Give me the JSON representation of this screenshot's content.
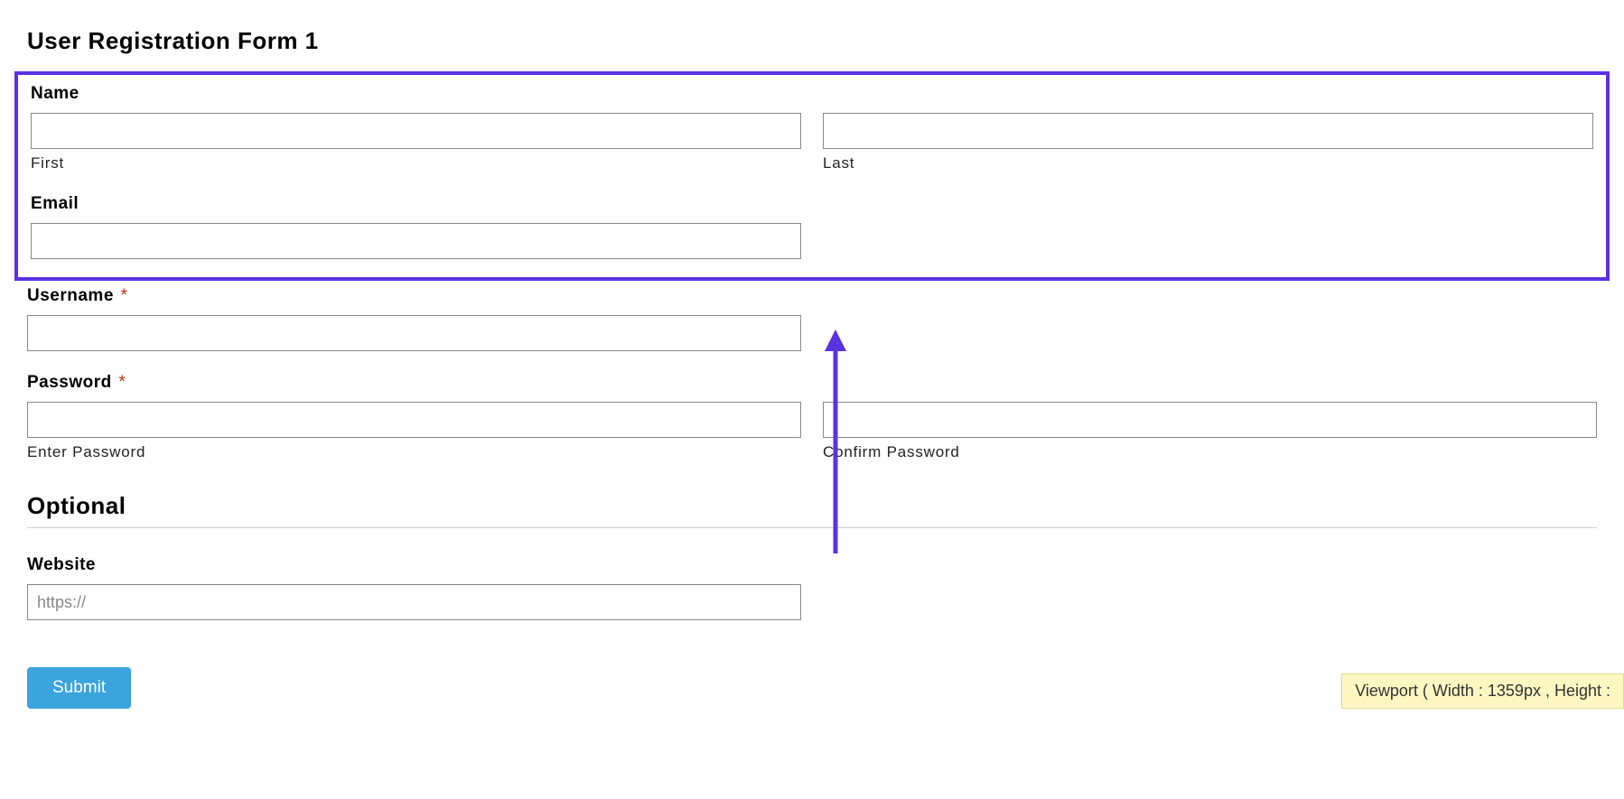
{
  "form": {
    "title": "User Registration Form 1",
    "name": {
      "label": "Name",
      "first": {
        "value": "",
        "sublabel": "First"
      },
      "last": {
        "value": "",
        "sublabel": "Last"
      }
    },
    "email": {
      "label": "Email",
      "value": ""
    },
    "username": {
      "label": "Username",
      "required_mark": "*",
      "value": ""
    },
    "password": {
      "label": "Password",
      "required_mark": "*",
      "enter": {
        "value": "",
        "sublabel": "Enter Password"
      },
      "confirm": {
        "value": "",
        "sublabel": "Confirm Password"
      }
    },
    "optional_section": {
      "heading": "Optional"
    },
    "website": {
      "label": "Website",
      "value": "",
      "placeholder": "https://"
    },
    "submit": {
      "label": "Submit"
    }
  },
  "annotation": {
    "highlight_color": "#5b32e0",
    "arrow_color": "#5b32e0"
  },
  "viewport_badge": {
    "text": "Viewport ( Width : 1359px , Height :"
  }
}
